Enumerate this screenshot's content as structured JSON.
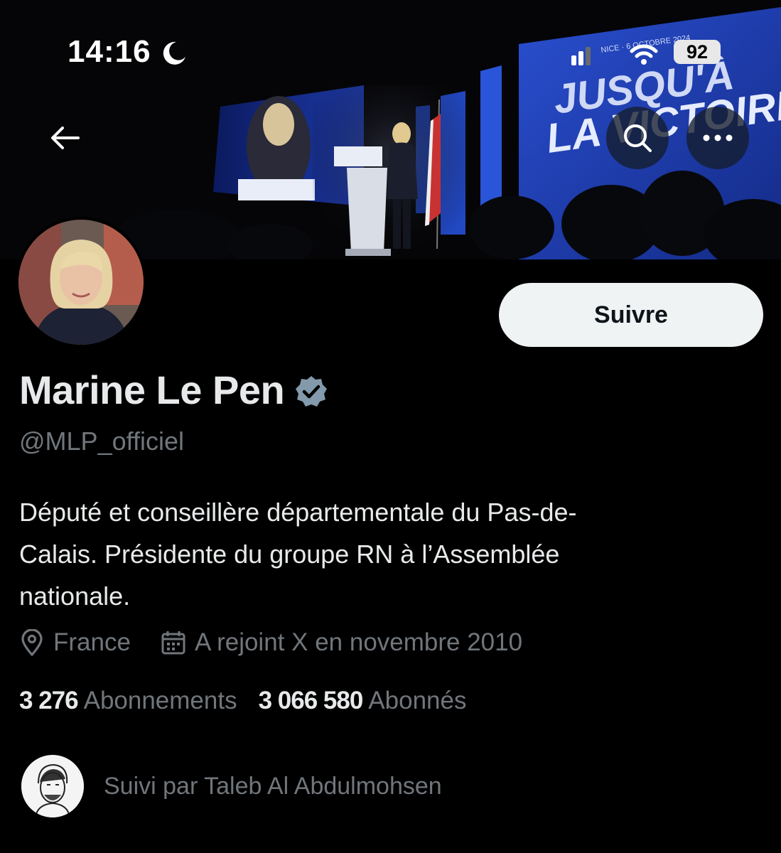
{
  "status_bar": {
    "time": "14:16",
    "battery": "92"
  },
  "banner": {
    "slogan_line1": "JUSQU'À",
    "slogan_line2": "LA VICTOIRE !",
    "event_text": "NICE · 6 OCTOBRE 2024"
  },
  "profile": {
    "display_name": "Marine Le Pen",
    "handle": "@MLP_officiel",
    "bio_line1": "Député et conseillère départementale du Pas-de-",
    "bio_line2": "Calais. Présidente du groupe RN à l’Assemblée",
    "bio_line3": "nationale.",
    "location": "France",
    "joined": "A rejoint X en novembre 2010",
    "following_count": "3 276",
    "following_label": "Abonnements",
    "followers_count": "3 066 580",
    "followers_label": "Abonnés",
    "followed_by": "Suivi par Taleb Al Abdulmohsen"
  },
  "actions": {
    "follow_label": "Suivre"
  },
  "colors": {
    "background": "#000000",
    "text_primary": "#e7e9ea",
    "text_secondary": "#71767b",
    "follow_button_bg": "#eff3f4",
    "verified_badge": "#829aab",
    "banner_screen_blue": "#1e3aa8"
  },
  "icons": [
    "moon-icon",
    "signal-icon",
    "wifi-icon",
    "back-arrow-icon",
    "search-icon",
    "more-icon",
    "verified-badge-icon",
    "location-pin-icon",
    "calendar-icon"
  ]
}
